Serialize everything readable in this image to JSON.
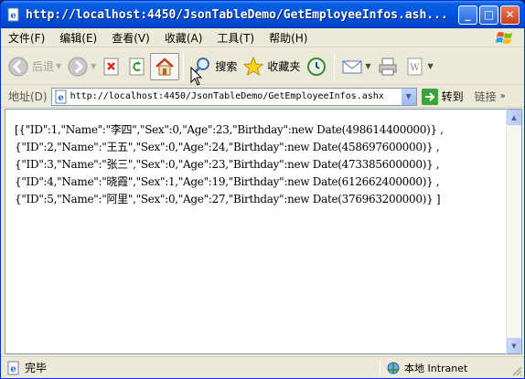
{
  "window": {
    "title": "http://localhost:4450/JsonTableDemo/GetEmployeeInfos.ash...",
    "minimize_label": "_",
    "maximize_label": "□",
    "close_label": "✕"
  },
  "menu": [
    "文件(F)",
    "编辑(E)",
    "查看(V)",
    "收藏(A)",
    "工具(T)",
    "帮助(H)"
  ],
  "toolbar": {
    "back_label": "后退",
    "search_label": "搜索",
    "favorites_label": "收藏夹",
    "icons": [
      "back-icon",
      "forward-icon",
      "stop-icon",
      "refresh-icon",
      "home-icon",
      "search-icon",
      "favorites-star-icon",
      "history-icon",
      "mail-icon",
      "print-icon",
      "edit-word-icon"
    ]
  },
  "address": {
    "label": "地址(D)",
    "url": "http://localhost:4450/JsonTableDemo/GetEmployeeInfos.ashx",
    "go_label": "转到",
    "links_label": "链接"
  },
  "content": {
    "lines": [
      "[{\"ID\":1,\"Name\":\"李四\",\"Sex\":0,\"Age\":23,\"Birthday\":new Date(498614400000)} ,",
      "{\"ID\":2,\"Name\":\"王五\",\"Sex\":0,\"Age\":24,\"Birthday\":new Date(458697600000)} ,",
      "{\"ID\":3,\"Name\":\"张三\",\"Sex\":0,\"Age\":23,\"Birthday\":new Date(473385600000)} ,",
      "{\"ID\":4,\"Name\":\"晓霞\",\"Sex\":1,\"Age\":19,\"Birthday\":new Date(612662400000)} ,",
      "{\"ID\":5,\"Name\":\"阿里\",\"Sex\":0,\"Age\":27,\"Birthday\":new Date(376963200000)} ]"
    ]
  },
  "status": {
    "text": "完毕",
    "zone": "本地 Intranet"
  },
  "colors": {
    "titlebar": "#0053e1",
    "chrome": "#ece9d8",
    "content_bg": "#ffffff"
  }
}
